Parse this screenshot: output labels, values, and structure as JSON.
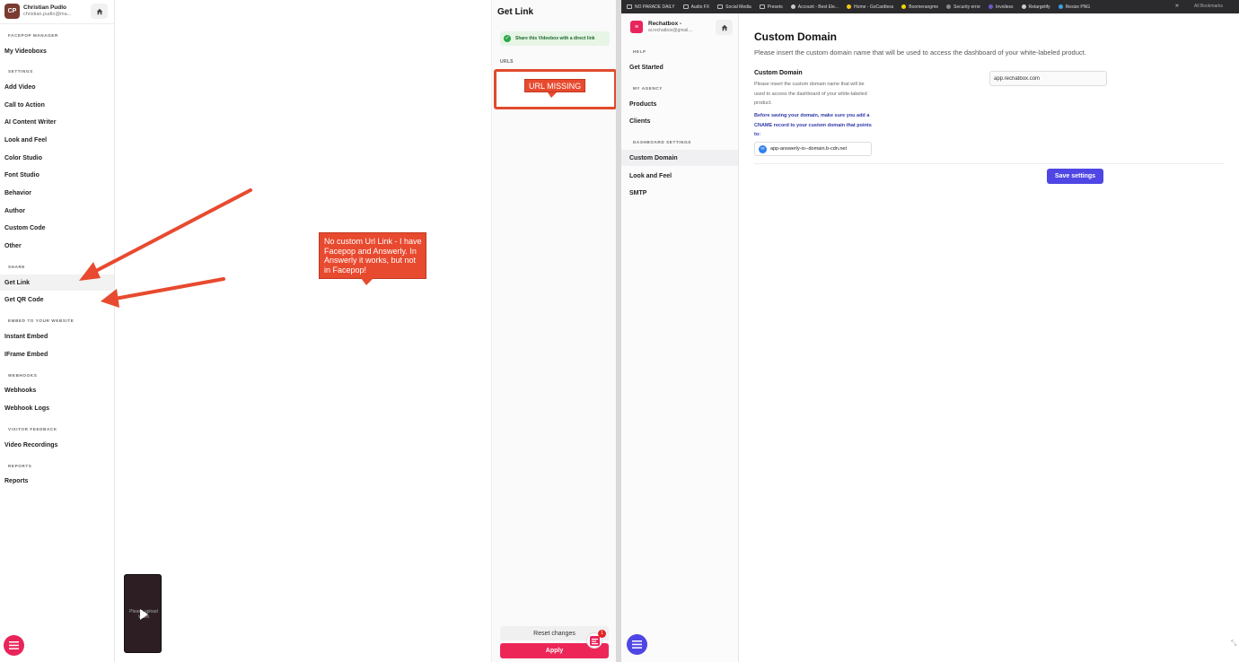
{
  "facepop": {
    "user": {
      "initials": "CP",
      "name": "Christian Pudlo",
      "email": "christian.pudlo@ma..."
    },
    "sections": {
      "manager": "FACEPOP MANAGER",
      "settings": "SETTINGS",
      "share": "SHARE",
      "embed": "EMBED TO YOUR WEBSITE",
      "webhooks": "WEBHOOKS",
      "feedback": "VISITOR FEEDBACK",
      "reports": "REPORTS"
    },
    "items": {
      "my_videoboxs": "My Videoboxs",
      "add_video": "Add Video",
      "call_to_action": "Call to Action",
      "ai_writer": "AI Content Writer",
      "look_feel": "Look and Feel",
      "color_studio": "Color Studio",
      "font_studio": "Font Studio",
      "behavior": "Behavior",
      "author": "Author",
      "custom_code": "Custom Code",
      "other": "Other",
      "get_link": "Get Link",
      "get_qr": "Get QR Code",
      "instant_embed": "Instant Embed",
      "iframe_embed": "IFrame Embed",
      "webhooks": "Webhooks",
      "webhook_logs": "Webhook Logs",
      "video_recordings": "Video Recordings",
      "reports": "Reports"
    },
    "video_preview_text": "Please upload Video"
  },
  "annotation": {
    "callout_text": "No custom Url Link - I have Facepop and Answerly. In Answerly it works, but not in Facepop!",
    "url_missing": "URL MISSING",
    "arrow_color": "#e84a2f"
  },
  "get_link_panel": {
    "title": "Get Link",
    "share_text": "Share this Videobox with a direct link",
    "urls_label": "URLS",
    "reset_label": "Reset changes",
    "apply_label": "Apply",
    "notification_count": "1"
  },
  "bookmarks": {
    "items": [
      "NO PARADE DAILY",
      "Audio FX",
      "Social Media",
      "Presets",
      "Account - Best Ele...",
      "Home - GoCardless",
      "Boomerangme",
      "Security error",
      "Invoiless",
      "Retargetify",
      "Resize PNG"
    ],
    "all_label": "All Bookmarks"
  },
  "rechatbox": {
    "brand_name": "Rechatbox -",
    "brand_email": "ai.rechatbox@gmail....",
    "sections": {
      "help": "HELP",
      "agency": "MY AGENCY",
      "dashboard": "DASHBOARD SETTINGS"
    },
    "items": {
      "get_started": "Get Started",
      "products": "Products",
      "clients": "Clients",
      "custom_domain": "Custom Domain",
      "look_feel": "Look and Feel",
      "smtp": "SMTP"
    }
  },
  "custom_domain": {
    "title": "Custom Domain",
    "subtitle": "Please insert the custom domain name that will be used to access the dashboard of your white-labeled product.",
    "field_label": "Custom Domain",
    "field_help": "Please insert the custom domain name that will be used to access the dashboard of your white-labeled product.",
    "field_note": "Before saving your domain, make sure you add a CNAME record to your custom domain that points to:",
    "cname_target": "app-answerly-io--domain.b-cdn.net",
    "domain_value": "app.rechatbox.com",
    "save_label": "Save settings"
  },
  "colors": {
    "facepop_accent": "#ec2758",
    "rechatbox_accent": "#4f46e5",
    "annotation_red": "#e84a2f"
  }
}
